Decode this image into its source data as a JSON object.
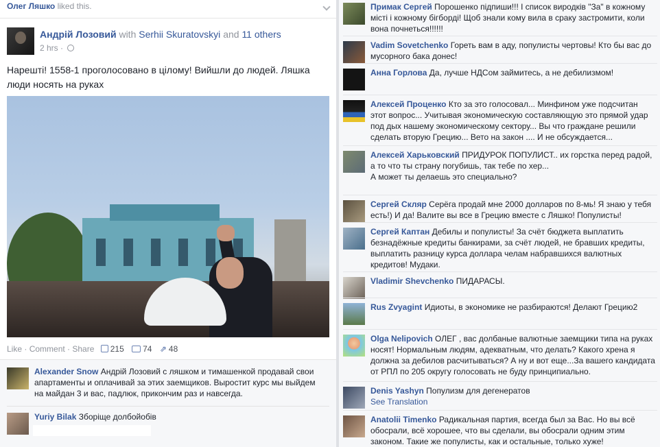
{
  "header": {
    "liker_name": "Олег Ляшко",
    "liked_text": "liked this."
  },
  "post": {
    "author": "Андрій Лозовий",
    "with_text": "with",
    "tagged": "Serhii Skuratovskyi",
    "and_text": "and",
    "others": "11 others",
    "time": "2 hrs",
    "text": "Нарешті! 1558-1 проголосовано в цілому! Вийшли до людей. Ляшка люди носять на руках",
    "actions": {
      "like": "Like",
      "comment": "Comment",
      "share": "Share",
      "likes_count": "215",
      "comments_count": "74",
      "shares_count": "48"
    }
  },
  "left_comments": [
    {
      "author": "Alexander Snow",
      "text": "Андрій Лозовий с ляшком и тимашенкой продавай свои апартаменты и оплачивай за этих заемщиков. Выростит курс мы выйдем на майдан 3 и вас, падлюк, прикончим раз и навсегда."
    },
    {
      "author": "Yuriy Bilak",
      "text": "Зборіще долбойобів"
    }
  ],
  "right_comments": [
    {
      "author": "Примак Сергей",
      "text": "Порошенко підпиши!!! І список виродків \"За\" в кожному місті і кожному бігборді! Щоб знали кому вила в сраку застромити, коли вона почнеться!!!!!!"
    },
    {
      "author": "Vadim Sovetchenko",
      "text": "Гореть вам в аду, популисты чертовы! Кто бы вас до мусорного бака донес!"
    },
    {
      "author": "Анна Горлова",
      "text": "Да, лучше НДСом займитесь, а не дебилизмом!"
    },
    {
      "author": "Алексей Проценко",
      "text": "Кто за это голосовал... Минфином уже подсчитан этот вопрос... Учитывая экономическую составляющую это прямой удар под дых нашему экономическому сектору... Вы что граждане решили сделать вторую Грецию... Вето на закон .... И не обсуждается..."
    },
    {
      "author": "Алексей Харьковский",
      "text": "ПРИДУРОК ПОПУЛИСТ.. их горстка перед радой,",
      "text2": "а то что ты страну погубишь, так тебе по хер...",
      "text3": "А может ты делаешь это специально?"
    },
    {
      "author": "Сергей Скляр",
      "text": "Серёга продай мне 2000 долларов по 8-мь! Я знаю у тебя есть!) И да! Валите вы все в Грецию вместе с Ляшко! Популисты!"
    },
    {
      "author": "Сергей Каптан",
      "text": "Дебилы и популисты! За счёт бюджета выплатить безнадёжные кредиты банкирами, за счёт людей, не бравших кредиты, выплатить разницу курса доллара челам набравшихся валютных кредитов! Мудаки."
    },
    {
      "author": "Vladimir Shevchenko",
      "text": "ПИДАРАСЫ."
    },
    {
      "author": "Rus Zvyagint",
      "text": "Идиоты, в экономике не разбираются! Делают Грецию2"
    },
    {
      "author": "Olga Nelipovich",
      "text": "ОЛЕГ , вас долбаные валютные заемщики типа на руках носят! Нормальным людям, адекватным, что делать? Какого хрена я должна за дебилов расчитываться? А ну и вот еще...За вашего кандидата от РПЛ по 205 округу голосовать не буду принципиально."
    },
    {
      "author": "Denis Yashyn",
      "text": "Популизм для дегенератов",
      "see_translation": "See Translation"
    },
    {
      "author": "Anatolii Timenko",
      "text": "Радикальная партия, всегда был за Вас. Но вы всё обосрали, всё хорошее, что вы сделали, вы обосрали одним этим законом. Такие же популисты, как и остальные, только хуже!"
    }
  ],
  "colors": {
    "link": "#365899",
    "meta": "#90949c",
    "text": "#1d2129",
    "panel": "#f6f7f9"
  }
}
